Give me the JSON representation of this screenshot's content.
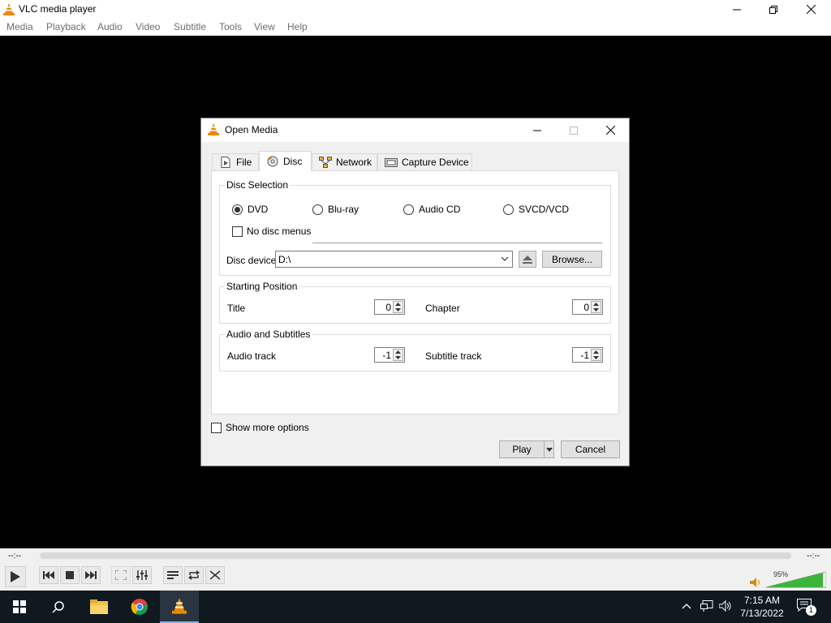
{
  "app": {
    "title": "VLC media player",
    "menu": [
      "Media",
      "Playback",
      "Audio",
      "Video",
      "Subtitle",
      "Tools",
      "View",
      "Help"
    ]
  },
  "controls": {
    "time_elapsed": "--:--",
    "time_total": "--:--",
    "volume_label": "95%",
    "volume_level": 0.95
  },
  "taskbar": {
    "time": "7:15 AM",
    "date": "7/13/2022",
    "notification_count": "1"
  },
  "dialog": {
    "title": "Open Media",
    "tabs": [
      {
        "label": "File",
        "icon": "file-icon"
      },
      {
        "label": "Disc",
        "icon": "disc-icon"
      },
      {
        "label": "Network",
        "icon": "network-icon"
      },
      {
        "label": "Capture Device",
        "icon": "capture-device-icon"
      }
    ],
    "active_tab": "Disc",
    "disc_selection": {
      "label": "Disc Selection",
      "options": [
        "DVD",
        "Blu-ray",
        "Audio CD",
        "SVCD/VCD"
      ],
      "selected": "DVD",
      "no_disc_menus_label": "No disc menus",
      "no_disc_menus_checked": false,
      "device_label": "Disc device",
      "device_value": "D:\\",
      "browse_label": "Browse..."
    },
    "starting_position": {
      "label": "Starting Position",
      "title_label": "Title",
      "title_value": "0",
      "chapter_label": "Chapter",
      "chapter_value": "0"
    },
    "audio_subtitles": {
      "label": "Audio and Subtitles",
      "audio_label": "Audio track",
      "audio_value": "-1",
      "subtitle_label": "Subtitle track",
      "subtitle_value": "-1"
    },
    "show_more_options_label": "Show more options",
    "play_label": "Play",
    "cancel_label": "Cancel"
  }
}
